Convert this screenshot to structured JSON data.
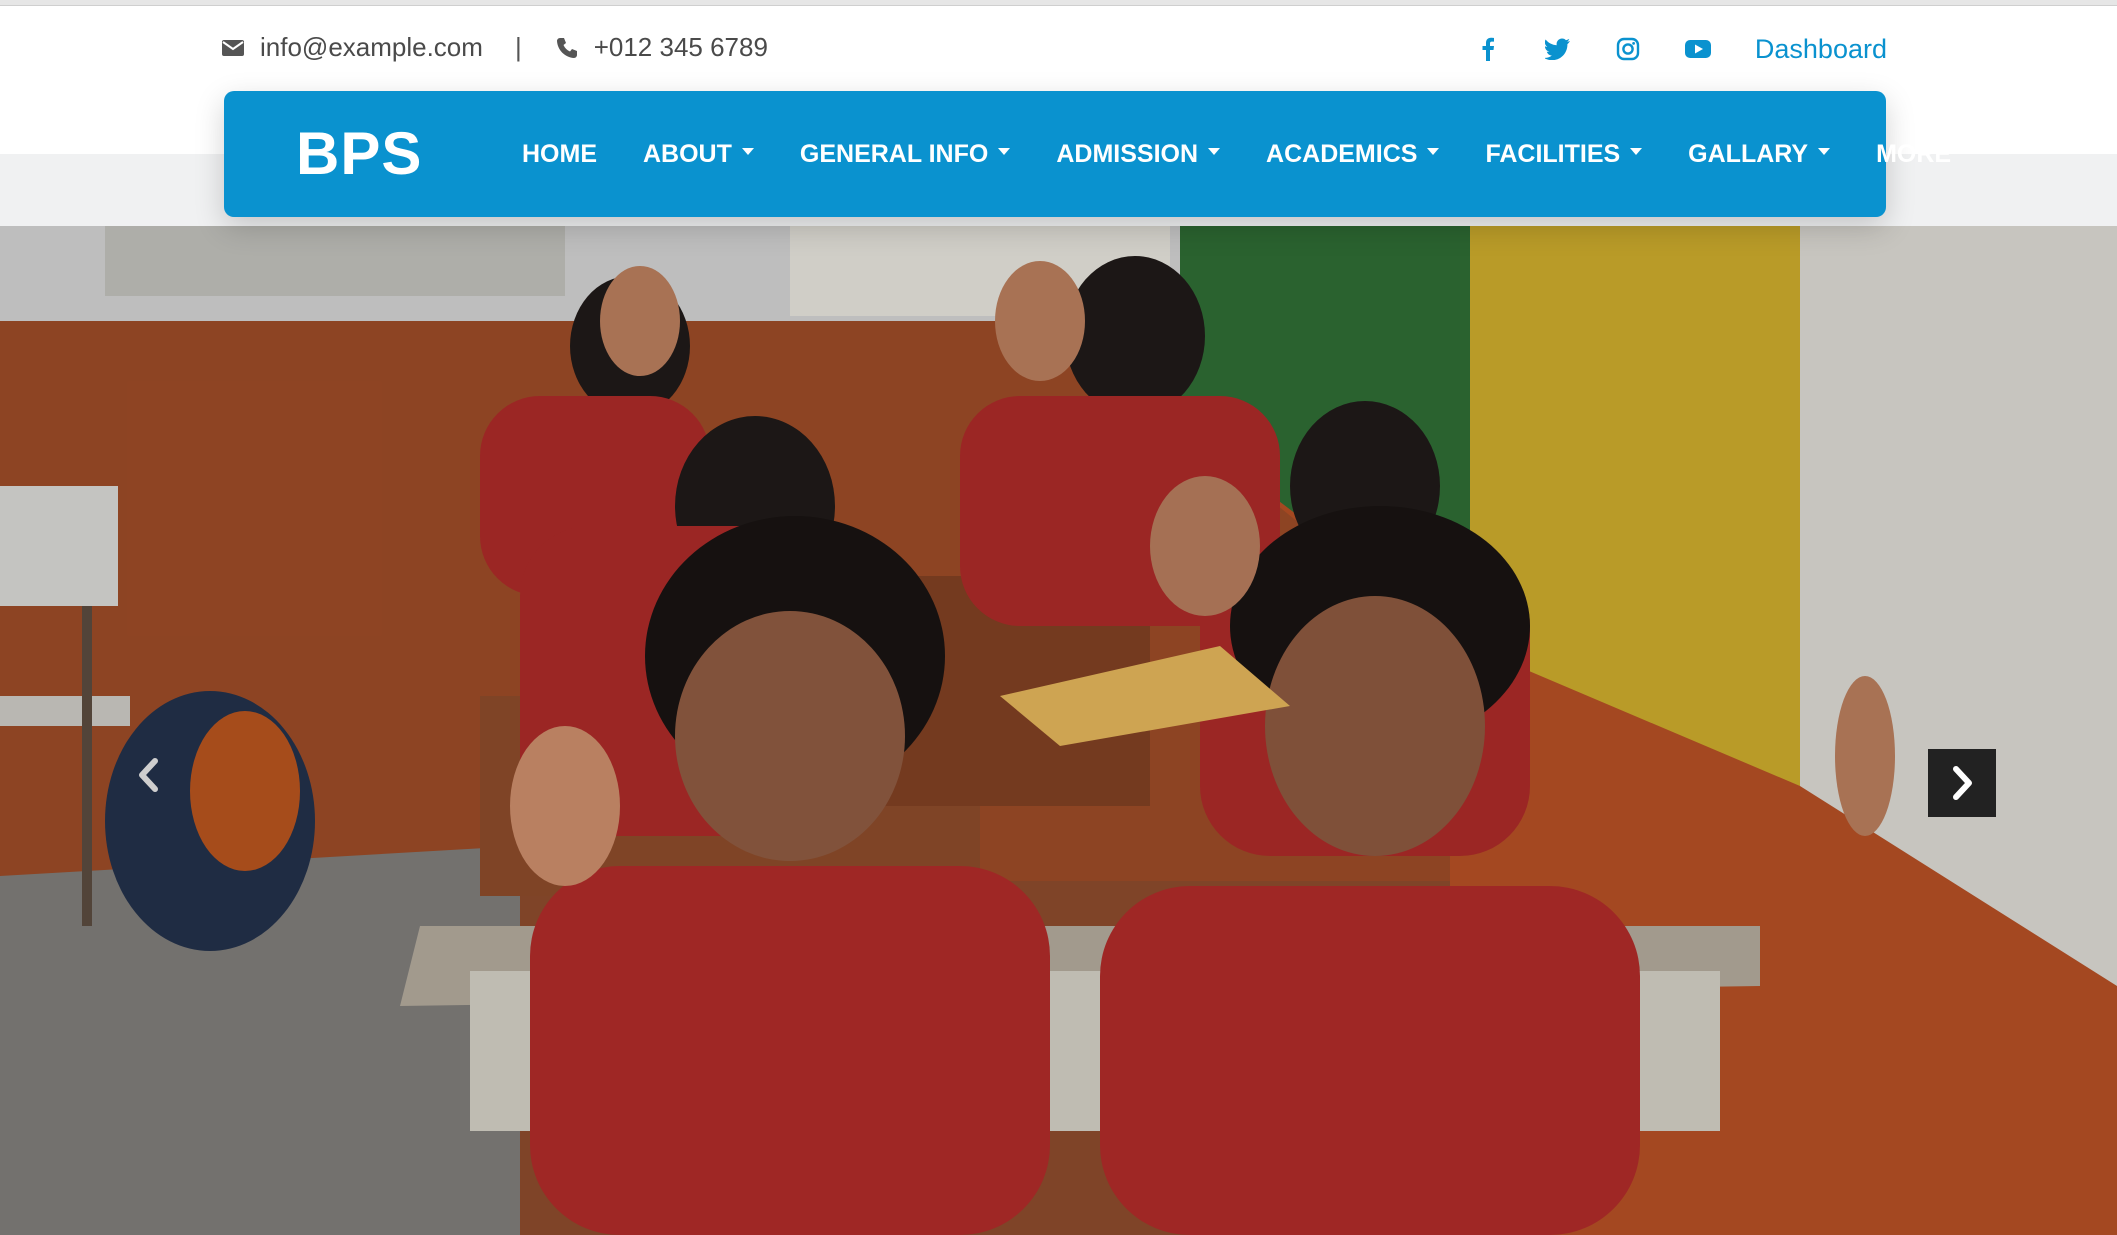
{
  "contact": {
    "email": "info@example.com",
    "separator": "|",
    "phone": "+012 345 6789"
  },
  "social": {
    "icons": [
      "facebook-icon",
      "twitter-icon",
      "instagram-icon",
      "youtube-icon"
    ],
    "dashboard_label": "Dashboard"
  },
  "navbar": {
    "brand": "BPS",
    "items": [
      {
        "label": "HOME",
        "dropdown": false
      },
      {
        "label": "ABOUT",
        "dropdown": true
      },
      {
        "label": "GENERAL INFO",
        "dropdown": true
      },
      {
        "label": "ADMISSION",
        "dropdown": true
      },
      {
        "label": "ACADEMICS",
        "dropdown": true
      },
      {
        "label": "FACILITIES",
        "dropdown": true
      },
      {
        "label": "GALLARY",
        "dropdown": true
      },
      {
        "label": "MORE",
        "dropdown": false
      }
    ]
  },
  "hero": {
    "controls": [
      "prev",
      "next"
    ]
  },
  "colors": {
    "accent": "#0a92cf",
    "text_dark": "#4a4a4a",
    "control_bg": "#222222"
  }
}
